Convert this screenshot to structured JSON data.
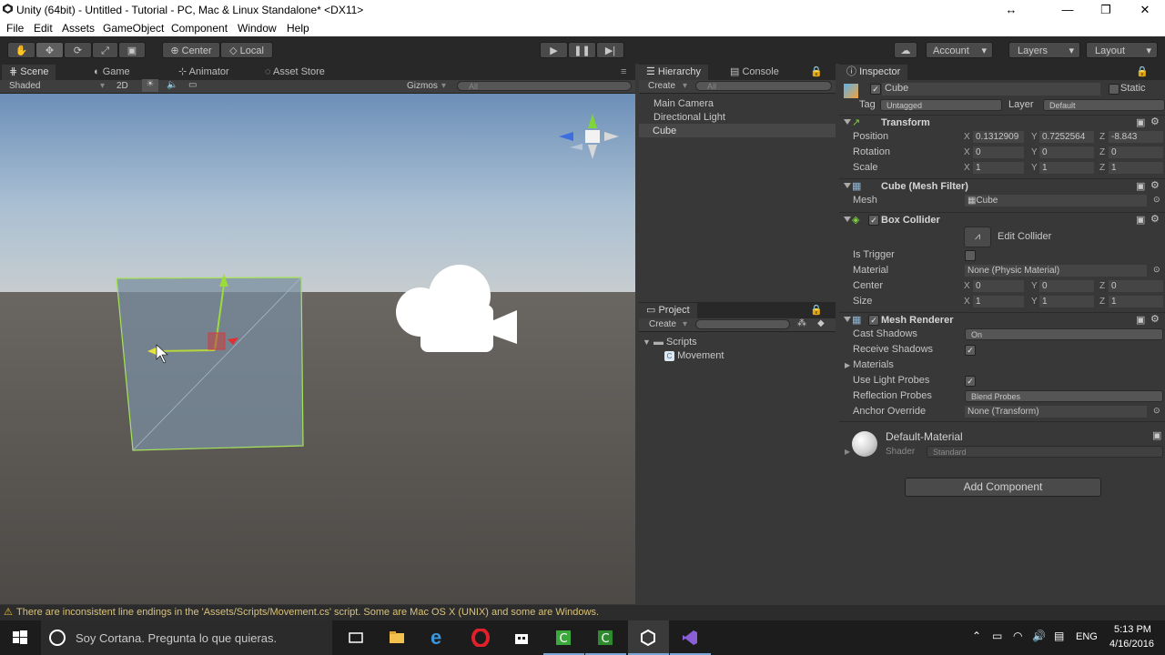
{
  "window": {
    "title": "Unity (64bit) - Untitled - Tutorial - PC, Mac & Linux Standalone* <DX11>"
  },
  "menu": [
    "File",
    "Edit",
    "Assets",
    "GameObject",
    "Component",
    "Window",
    "Help"
  ],
  "toolbar": {
    "pivot_label": "Center",
    "space_label": "Local",
    "account_label": "Account",
    "layers_label": "Layers",
    "layout_label": "Layout"
  },
  "scene": {
    "tabs": [
      "Scene",
      "Game",
      "Animator",
      "Asset Store"
    ],
    "shading": "Shaded",
    "mode_2d": "2D",
    "gizmos": "Gizmos",
    "search_placeholder": "All"
  },
  "hierarchy": {
    "tabs": [
      "Hierarchy",
      "Console"
    ],
    "create": "Create",
    "search_placeholder": "All",
    "items": [
      "Main Camera",
      "Directional Light",
      "Cube"
    ],
    "selected_index": 2
  },
  "project": {
    "tab": "Project",
    "create": "Create",
    "folder": "Scripts",
    "file": "Movement"
  },
  "inspector": {
    "tab": "Inspector",
    "object_name": "Cube",
    "static_label": "Static",
    "tag_label": "Tag",
    "tag_value": "Untagged",
    "layer_label": "Layer",
    "layer_value": "Default",
    "transform": {
      "title": "Transform",
      "position_label": "Position",
      "rotation_label": "Rotation",
      "scale_label": "Scale",
      "position": [
        "0.1312909",
        "0.7252564",
        "-8.843"
      ],
      "rotation": [
        "0",
        "0",
        "0"
      ],
      "scale": [
        "1",
        "1",
        "1"
      ]
    },
    "mesh_filter": {
      "title": "Cube (Mesh Filter)",
      "mesh_label": "Mesh",
      "mesh_value": "Cube"
    },
    "box_collider": {
      "title": "Box Collider",
      "edit_label": "Edit Collider",
      "is_trigger_label": "Is Trigger",
      "material_label": "Material",
      "material_value": "None (Physic Material)",
      "center_label": "Center",
      "center": [
        "0",
        "0",
        "0"
      ],
      "size_label": "Size",
      "size": [
        "1",
        "1",
        "1"
      ]
    },
    "mesh_renderer": {
      "title": "Mesh Renderer",
      "cast_shadows_label": "Cast Shadows",
      "cast_shadows_value": "On",
      "receive_shadows_label": "Receive Shadows",
      "materials_label": "Materials",
      "use_light_probes_label": "Use Light Probes",
      "reflection_probes_label": "Reflection Probes",
      "reflection_probes_value": "Blend Probes",
      "anchor_override_label": "Anchor Override",
      "anchor_override_value": "None (Transform)"
    },
    "material": {
      "name": "Default-Material",
      "shader_label": "Shader",
      "shader_value": "Standard"
    },
    "add_component": "Add Component",
    "axes": [
      "X",
      "Y",
      "Z"
    ]
  },
  "status": {
    "message": "There are inconsistent line endings in the 'Assets/Scripts/Movement.cs' script. Some are Mac OS X (UNIX) and some are Windows."
  },
  "taskbar": {
    "cortana_placeholder": "Soy Cortana. Pregunta lo que quieras.",
    "language": "ENG",
    "time": "5:13 PM",
    "date": "4/16/2016"
  },
  "colors": {
    "accent_blue": "#3e5f96",
    "warning_yellow": "#f0c030",
    "cube_outline": "#a6e35a"
  }
}
